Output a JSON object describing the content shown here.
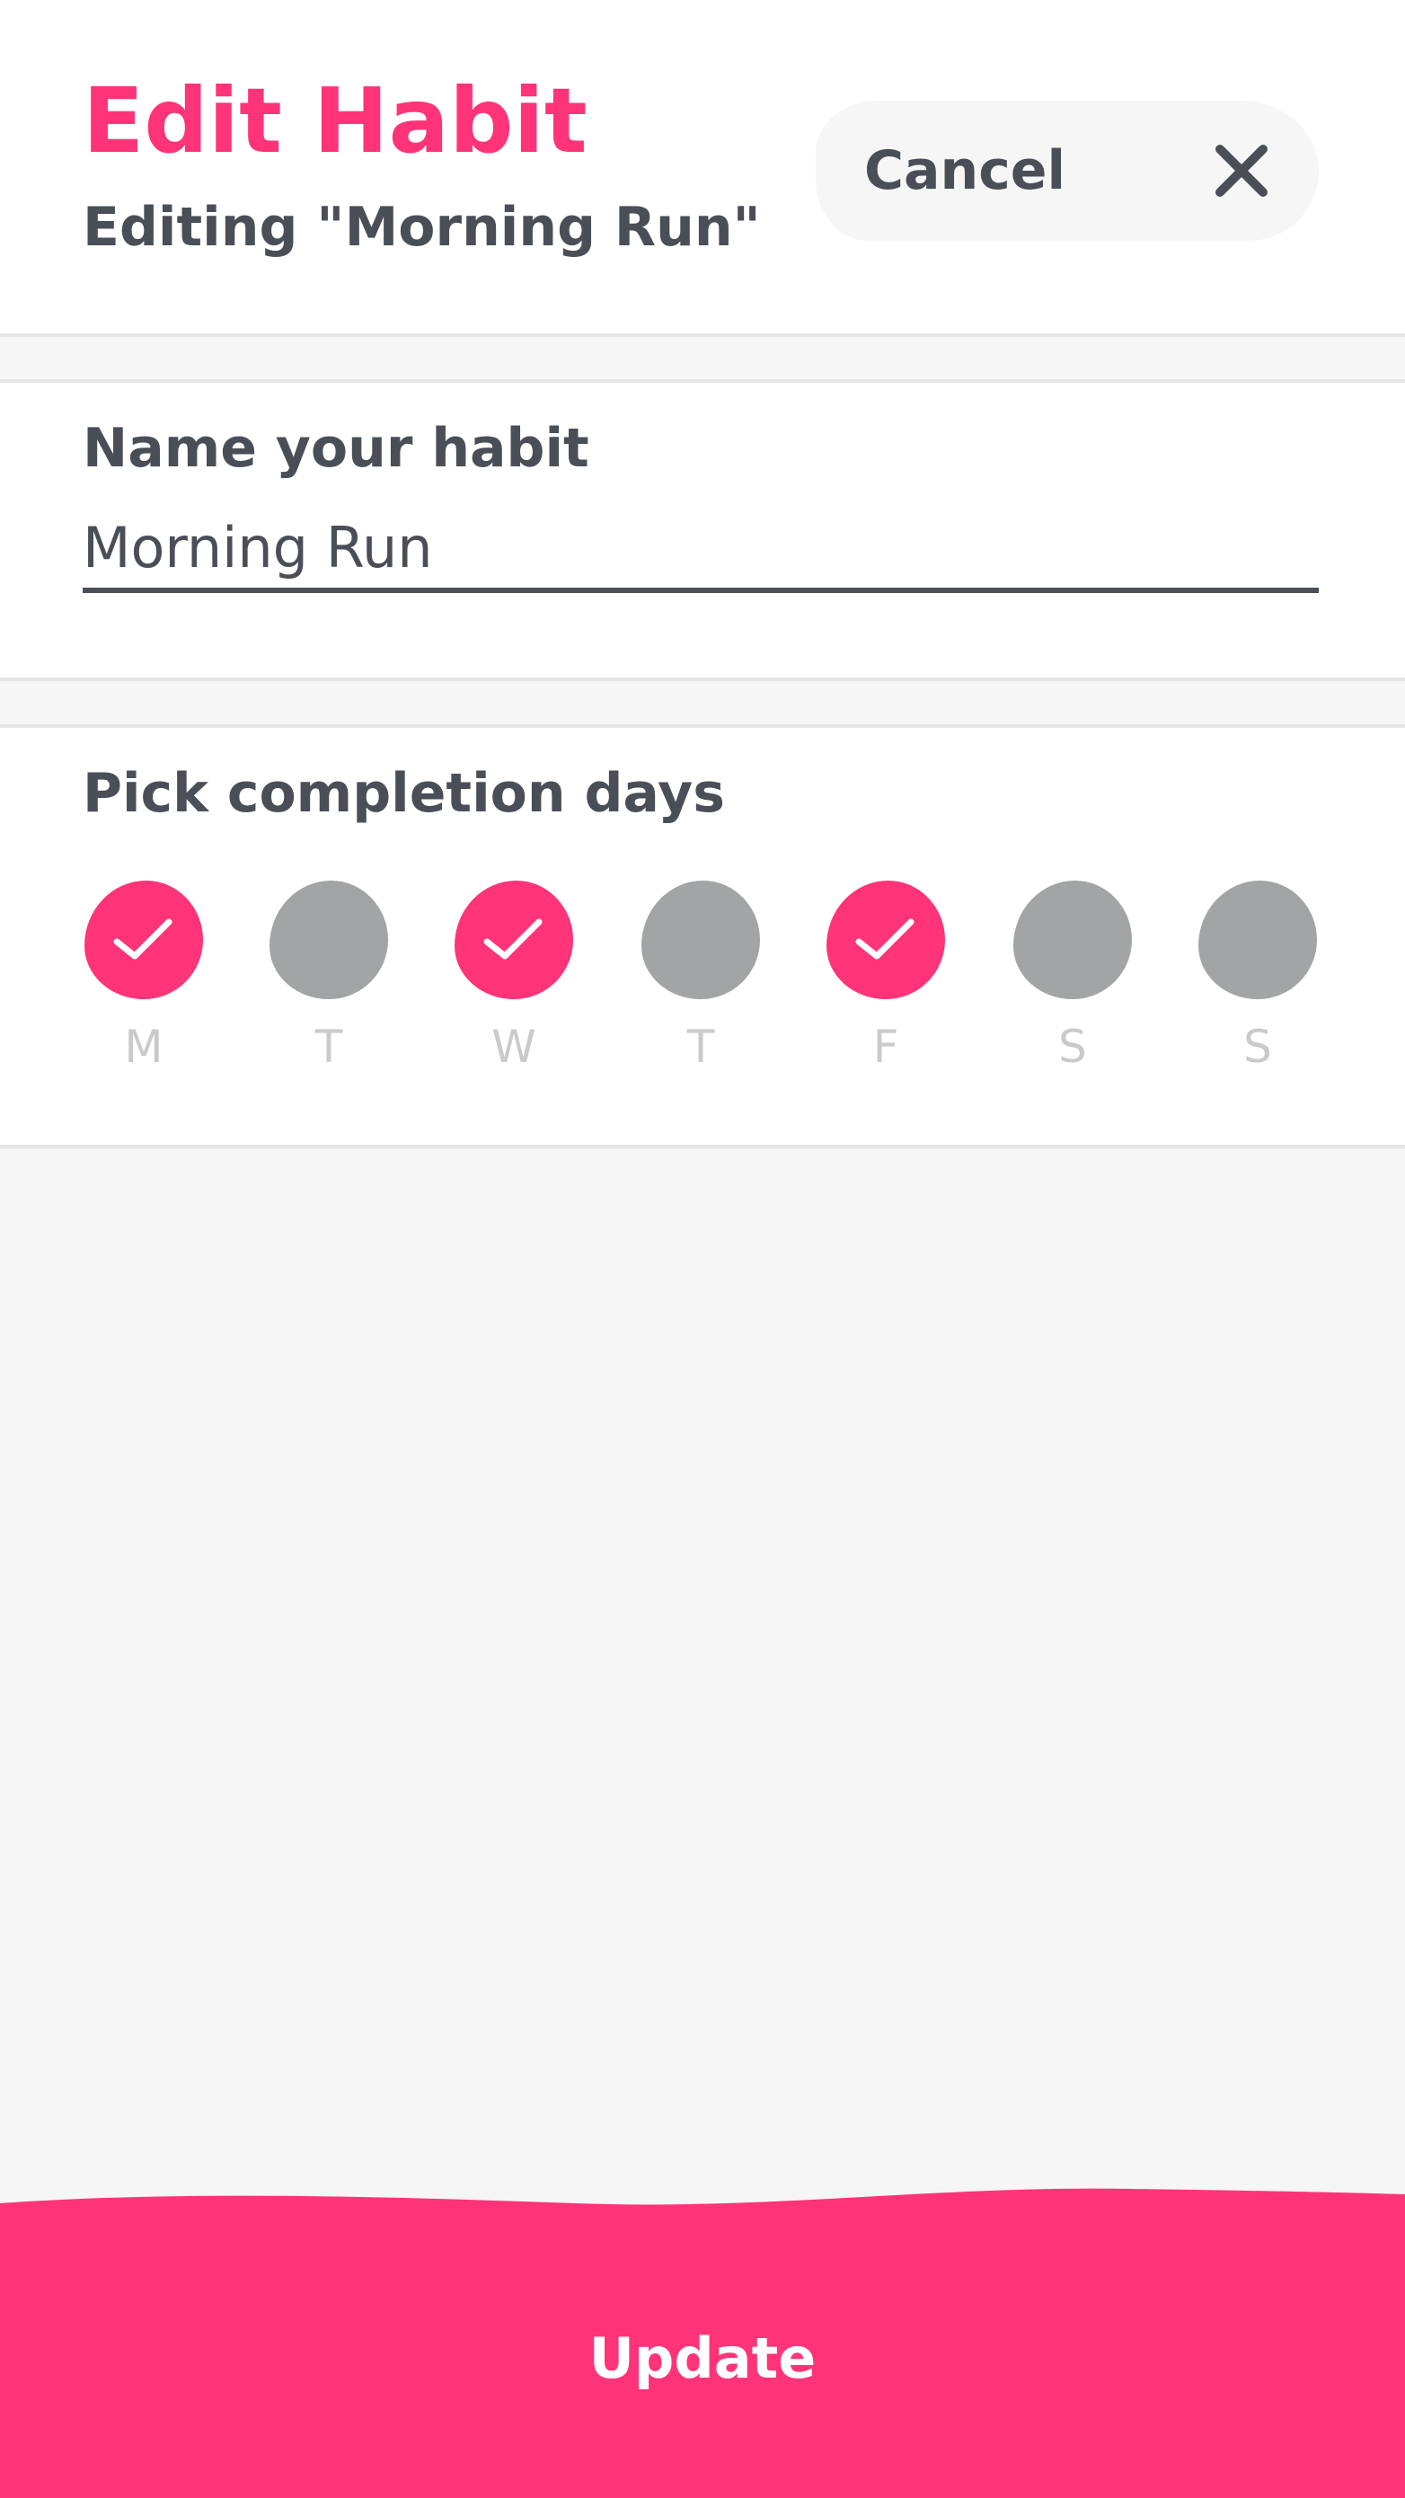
{
  "header": {
    "title": "Edit Habit",
    "subtitle": "Editing \"Morning Run\"",
    "cancel_label": "Cancel"
  },
  "name_section": {
    "label": "Name your habit",
    "input_value": "Morning Run"
  },
  "days_section": {
    "label": "Pick completion days",
    "days": [
      {
        "letter": "M",
        "selected": true
      },
      {
        "letter": "T",
        "selected": false
      },
      {
        "letter": "W",
        "selected": true
      },
      {
        "letter": "T",
        "selected": false
      },
      {
        "letter": "F",
        "selected": true
      },
      {
        "letter": "S",
        "selected": false
      },
      {
        "letter": "S",
        "selected": false
      }
    ]
  },
  "footer": {
    "update_label": "Update"
  },
  "colors": {
    "accent": "#ff3478",
    "text": "#4a4f57",
    "unselected_day": "#a2a4a5",
    "day_letter": "#c9cacb",
    "background": "#f6f6f6"
  },
  "icons": {
    "cancel": "close-icon",
    "selected_day": "check-icon"
  }
}
